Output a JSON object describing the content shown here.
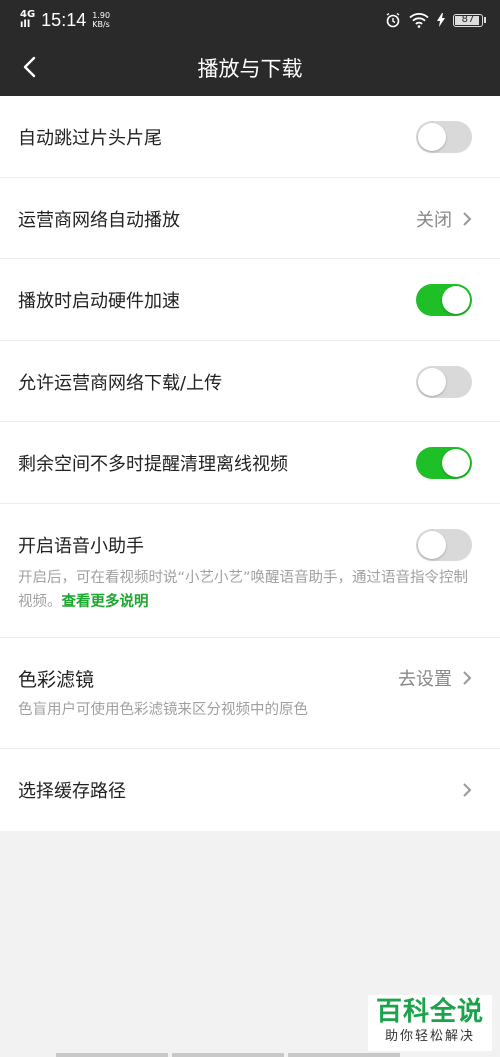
{
  "status": {
    "network": "4G",
    "signal": "ıll",
    "time": "15:14",
    "speed_value": "1.90",
    "speed_unit": "KB/s",
    "battery": "87"
  },
  "header": {
    "title": "播放与下载"
  },
  "settings": {
    "skip_intro": {
      "label": "自动跳过片头片尾",
      "enabled": false
    },
    "carrier_autoplay": {
      "label": "运营商网络自动播放",
      "value": "关闭"
    },
    "hw_accel": {
      "label": "播放时启动硬件加速",
      "enabled": true
    },
    "carrier_download": {
      "label": "允许运营商网络下载/上传",
      "enabled": false
    },
    "low_space": {
      "label": "剩余空间不多时提醒清理离线视频",
      "enabled": true
    },
    "voice_assistant": {
      "label": "开启语音小助手",
      "enabled": false,
      "desc": "开启后，可在看视频时说“小艺小艺”唤醒语音助手，通过语音指令控制视频。",
      "link": "查看更多说明"
    },
    "color_filter": {
      "label": "色彩滤镜",
      "value": "去设置",
      "desc": "色盲用户可使用色彩滤镜来区分视频中的原色"
    },
    "cache_path": {
      "label": "选择缓存路径"
    }
  },
  "watermark": {
    "main": "百科全说",
    "sub": "助你轻松解决"
  },
  "colors": {
    "toggle_on": "#1fbf28",
    "link": "#1fa631",
    "header_bg": "#2a2a2a"
  }
}
